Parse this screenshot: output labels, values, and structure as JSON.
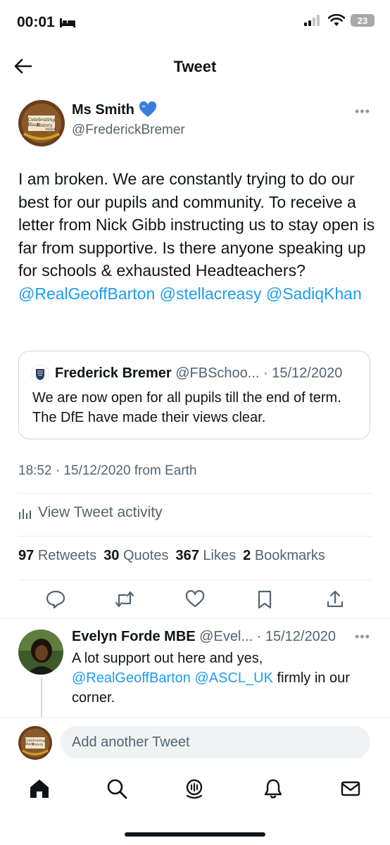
{
  "status": {
    "time": "00:01",
    "battery": "23"
  },
  "header": {
    "title": "Tweet"
  },
  "tweet": {
    "author_name": "Ms Smith",
    "author_handle": "@FrederickBremer",
    "avatar_text": [
      "Celebrating",
      "Black",
      "History",
      "Month"
    ],
    "body_plain": "I am broken. We are constantly trying to do our best for our pupils and community. To receive a letter from Nick Gibb instructing us to stay open is far from supportive. Is there anyone speaking up for schools & exhausted Headteachers?",
    "mention_1": "@RealGeoffBarton",
    "mention_2": "@stellacreasy",
    "mention_3": "@SadiqKhan",
    "timestamp": "18:52 · 15/12/2020 from Earth",
    "activity_label": "View Tweet activity",
    "stats": {
      "retweets_count": "97",
      "retweets_label": "Retweets",
      "quotes_count": "30",
      "quotes_label": "Quotes",
      "likes_count": "367",
      "likes_label": "Likes",
      "bookmarks_count": "2",
      "bookmarks_label": "Bookmarks"
    }
  },
  "quote": {
    "name": "Frederick Bremer",
    "handle": "@FBSchoo...",
    "date": "· 15/12/2020",
    "text": "We are now open for all pupils till the end of term. The DfE have made their views clear."
  },
  "reply": {
    "name": "Evelyn Forde MBE",
    "handle": "@Evel...",
    "date": "· 15/12/2020",
    "text_1": "A lot support out here and yes,",
    "mention_1": "@RealGeoffBarton",
    "mention_2": "@ASCL_UK",
    "text_2": "firmly in our corner."
  },
  "compose": {
    "placeholder": "Add another Tweet"
  },
  "icons": {
    "back": "arrow-left-icon",
    "more": "more-dots-icon",
    "verified": "blue-heart-icon",
    "reply": "comment-icon",
    "retweet": "retweet-icon",
    "like": "heart-icon",
    "bookmark": "bookmark-icon",
    "share": "share-icon",
    "home": "home-icon",
    "search": "search-icon",
    "spaces": "spaces-icon",
    "notifications": "bell-icon",
    "messages": "mail-icon"
  },
  "colors": {
    "link": "#1d9bf0",
    "text": "#0f1419",
    "muted": "#536471",
    "heart": "#3b7ddd"
  }
}
